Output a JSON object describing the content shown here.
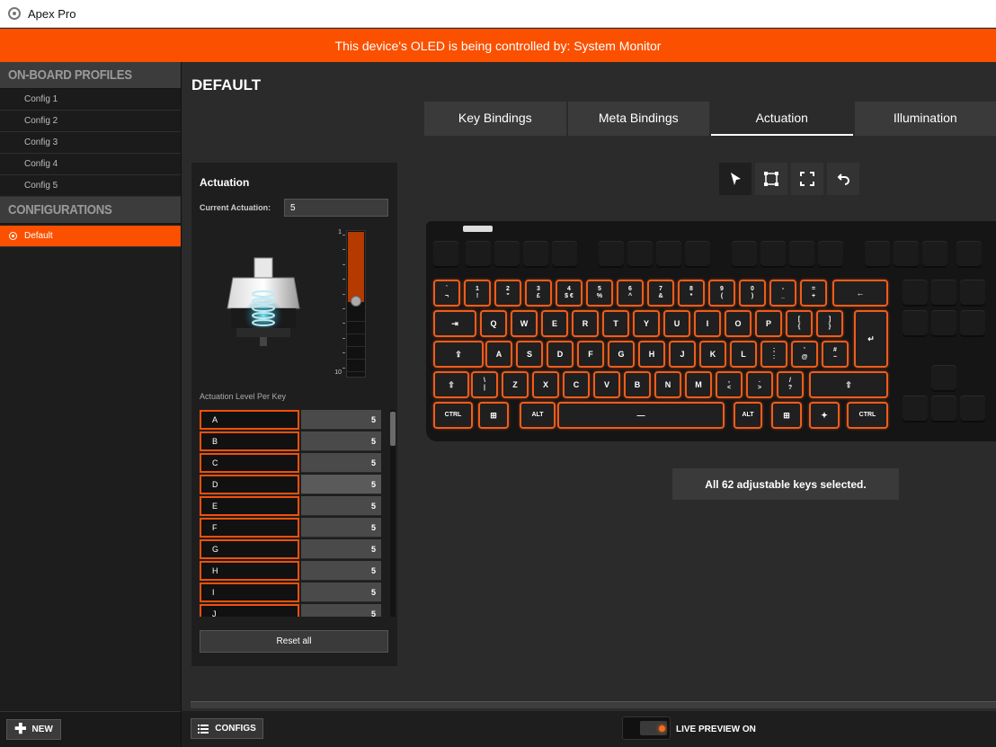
{
  "window": {
    "title": "Apex Pro"
  },
  "banner": {
    "text": "This device's OLED is being controlled by: System Monitor"
  },
  "sidebar": {
    "profiles_header": "ON-BOARD PROFILES",
    "profiles": [
      "Config 1",
      "Config 2",
      "Config 3",
      "Config 4",
      "Config 5"
    ],
    "configurations_header": "CONFIGURATIONS",
    "configurations": [
      {
        "label": "Default",
        "active": true
      }
    ],
    "new_label": "NEW"
  },
  "main": {
    "title": "DEFAULT",
    "tabs": [
      {
        "label": "Key Bindings",
        "active": false
      },
      {
        "label": "Meta Bindings",
        "active": false
      },
      {
        "label": "Actuation",
        "active": true
      },
      {
        "label": "Illumination",
        "active": false
      }
    ]
  },
  "actuation": {
    "title": "Actuation",
    "current_label": "Current Actuation:",
    "current_value": "5",
    "scale_min_label": "1",
    "scale_max_label": "10",
    "level": 5,
    "level_min": 1,
    "level_max": 10,
    "per_key_label": "Actuation Level Per Key",
    "keys": [
      {
        "key": "A",
        "value": "5"
      },
      {
        "key": "B",
        "value": "5"
      },
      {
        "key": "C",
        "value": "5"
      },
      {
        "key": "D",
        "value": "5"
      },
      {
        "key": "E",
        "value": "5"
      },
      {
        "key": "F",
        "value": "5"
      },
      {
        "key": "G",
        "value": "5"
      },
      {
        "key": "H",
        "value": "5"
      },
      {
        "key": "I",
        "value": "5"
      },
      {
        "key": "J",
        "value": "5"
      }
    ],
    "reset_label": "Reset all"
  },
  "toolbar": {
    "tools": [
      "cursor-icon",
      "select-box-icon",
      "expand-icon",
      "undo-icon"
    ],
    "active_tool": "cursor-icon"
  },
  "keyboard": {
    "row1": [
      "`\n¬",
      "1\n!",
      "2\n\"",
      "3\n£",
      "4\n$ €",
      "5\n%",
      "6\n^",
      "7\n&",
      "8\n*",
      "9\n(",
      "0\n)",
      "-\n_",
      "=\n+",
      "←"
    ],
    "row2": [
      "⇥",
      "Q",
      "W",
      "E",
      "R",
      "T",
      "Y",
      "U",
      "I",
      "O",
      "P",
      "[\n{",
      "]\n}"
    ],
    "enter": "↵",
    "row3": [
      "⇪",
      "A",
      "S",
      "D",
      "F",
      "G",
      "H",
      "J",
      "K",
      "L",
      ";\n:",
      "'\n@",
      "#\n~"
    ],
    "row4": [
      "⇧",
      "\\\n|",
      "Z",
      "X",
      "C",
      "V",
      "B",
      "N",
      "M",
      ",\n<",
      ".\n>",
      "/\n?",
      "⇧"
    ],
    "row5": [
      "CTRL",
      "⊞",
      "ALT",
      "—",
      "ALT",
      "⊞",
      "✦",
      "CTRL"
    ]
  },
  "selection_message": "All 62 adjustable keys selected.",
  "bottom": {
    "configs_label": "CONFIGS",
    "live_preview_label": "LIVE PREVIEW ON"
  },
  "colors": {
    "accent": "#fb5000",
    "key_outline": "#ef5c1c",
    "background": "#2b2b2b"
  }
}
